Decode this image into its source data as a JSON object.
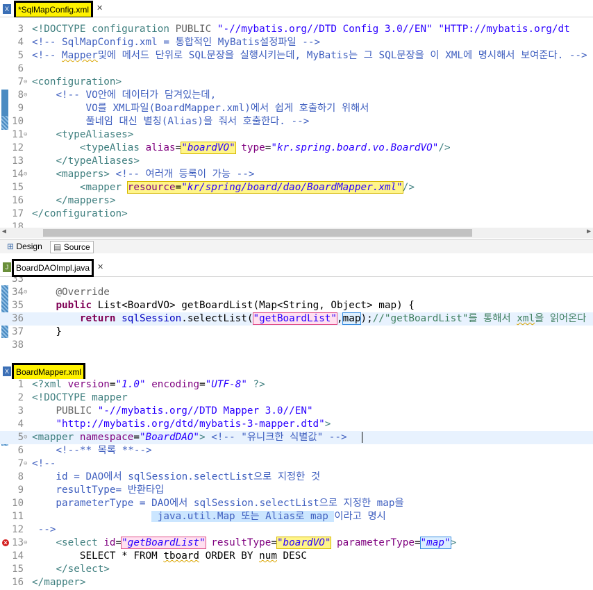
{
  "panel1": {
    "tab_title": "*SqlMapConfig.xml",
    "file_icon": "xml-file-icon",
    "lines": [
      {
        "n": "3",
        "html": "<span class='c-doc'>&lt;!DOCTYPE configuration</span> <span class='c-ann'>PUBLIC</span> <span class='c-str'>\"-//mybatis.org//DTD Config 3.0//EN\"</span> <span class='c-str'>\"HTTP://mybatis.org/dt</span>"
      },
      {
        "n": "4",
        "html": "<span class='c-com'>&lt;!-- SqlMapConfig.xml = 통합적인 MyBatis설정파일 --&gt;</span>"
      },
      {
        "n": "5",
        "html": "<span class='c-com'>&lt;!-- <span class='sq'>Mapper</span>및에 메서드 단위로 SQL문장을 실행시키는데, MyBatis는 그 SQL문장을 이 XML에 명시해서 보여준다. --&gt;</span>"
      },
      {
        "n": "6",
        "html": ""
      },
      {
        "n": "7",
        "fold": "⊖",
        "html": "<span class='c-tag'>&lt;configuration&gt;</span>"
      },
      {
        "n": "8",
        "fold": "⊖",
        "html": "    <span class='c-com'>&lt;!-- VO안에 데이터가 담겨있는데,</span>"
      },
      {
        "n": "9",
        "html": "<span class='c-com'>         VO를 XML파일(BoardMapper.xml)에서 쉽게 호출하기 위해서</span>"
      },
      {
        "n": "10",
        "html": "<span class='c-com'>         풀네임 대신 별칭(Alias)을 줘서 호출한다. --&gt;</span>"
      },
      {
        "n": "11",
        "fold": "⊖",
        "html": "    <span class='c-tag'>&lt;typeAliases&gt;</span>"
      },
      {
        "n": "12",
        "html": "        <span class='c-tag'>&lt;typeAlias</span> <span class='c-attr'>alias</span>=<span class='c-val box-yellow'>\"boardVO\"</span> <span class='c-attr'>type</span>=<span class='c-val'>\"kr.spring.board.vo.BoardVO\"</span><span class='c-tag'>/&gt;</span>"
      },
      {
        "n": "13",
        "html": "    <span class='c-tag'>&lt;/typeAliases&gt;</span>"
      },
      {
        "n": "14",
        "fold": "⊖",
        "html": "    <span class='c-tag'>&lt;mappers&gt;</span> <span class='c-com'>&lt;!-- 여러개 등록이 가능 --&gt;</span>"
      },
      {
        "n": "15",
        "html": "        <span class='c-tag'>&lt;mapper</span> <span class='box-yellow'><span class='c-attr'>resource</span>=<span class='c-val'>\"kr/spring/board/dao/BoardMapper.xml\"</span></span><span class='c-tag'>/&gt;</span>"
      },
      {
        "n": "16",
        "html": "    <span class='c-tag'>&lt;/mappers&gt;</span>"
      },
      {
        "n": "17",
        "html": "<span class='c-tag'>&lt;/configuration&gt;</span>"
      },
      {
        "n": "18",
        "html": ""
      }
    ],
    "bottom_tabs": [
      "Design",
      "Source"
    ]
  },
  "panel2": {
    "tab_title": "BoardDAOImpl.java",
    "file_icon": "java-file-icon",
    "lines": [
      {
        "n": "33",
        "html": ""
      },
      {
        "n": "34",
        "fold": "⊖",
        "html": "    <span class='c-ann'>@Override</span>"
      },
      {
        "n": "35",
        "html": "    <span class='c-kw'>public</span> List&lt;BoardVO&gt; getBoardList(Map&lt;String, Object&gt; map) {"
      },
      {
        "n": "36",
        "cur": true,
        "html": "        <span class='c-kw'>return</span> <span style='color:#0000c0'>sqlSession</span>.selectList(<span class='box-pink c-str'>\"getBoardList\"</span>,<span class='box-blue'>map</span>);<span style='color:#3f7f5f'>//\"getBoardList\"를 통해서 <span class='sq'>xml</span>을 읽어온다</span>"
      },
      {
        "n": "37",
        "html": "    }"
      },
      {
        "n": "38",
        "html": ""
      }
    ]
  },
  "panel3": {
    "tab_title": "BoardMapper.xml",
    "file_icon": "xml-file-icon",
    "lines": [
      {
        "n": "1",
        "html": "<span class='c-tag'>&lt;?xml</span> <span class='c-attr'>version</span>=<span class='c-val'>\"1.0\"</span> <span class='c-attr'>encoding</span>=<span class='c-val'>\"UTF-8\"</span> <span class='c-tag'>?&gt;</span>"
      },
      {
        "n": "2",
        "html": "<span class='c-doc'>&lt;!DOCTYPE mapper</span>"
      },
      {
        "n": "3",
        "html": "    <span class='c-ann'>PUBLIC</span> <span class='c-str'>\"-//mybatis.org//DTD Mapper 3.0//EN\"</span>"
      },
      {
        "n": "4",
        "html": "    <span class='c-str'>\"http://mybatis.org/dtd/mybatis-3-mapper.dtd\"</span><span class='c-doc'>&gt;</span>"
      },
      {
        "n": "5",
        "fold": "⊖",
        "cur": true,
        "html": "<span class='c-tag'>&lt;mapper</span> <span class='c-attr'>namespace</span>=<span class='c-val'>\"BoardDAO\"</span><span class='c-tag'>&gt;</span> <span class='c-com'>&lt;!-- \"유니크한 식별값\" --&gt;</span>"
      },
      {
        "n": "6",
        "html": "    <span class='c-com'>&lt;!--** 목록 **--&gt;</span>"
      },
      {
        "n": "7",
        "fold": "⊖",
        "html": "<span class='c-com'>&lt;!--</span>"
      },
      {
        "n": "8",
        "html": "<span class='c-com'>    id = DAO에서 sqlSession.selectList으로 지정한 것</span>"
      },
      {
        "n": "9",
        "html": "<span class='c-com'>    resultType= 반환타입</span>"
      },
      {
        "n": "10",
        "html": "<span class='c-com'>    parameterType = DAO에서 sqlSession.selectList으로 지정한 map을</span>"
      },
      {
        "n": "11",
        "html": "<span class='c-com'>                    <span class='box-lblue'> java.util.Map 또는 Alias로 map </span>이라고 명시</span>"
      },
      {
        "n": "12",
        "html": "<span class='c-com'> --&gt;</span>"
      },
      {
        "n": "13",
        "fold": "⊖",
        "err": true,
        "html": "    <span class='c-tag'>&lt;select</span> <span class='c-attr'>id</span>=<span class='c-val box-pink'>\"getBoardList\"</span> <span class='c-attr'>resultType</span>=<span class='c-val box-yellow'>\"boardVO\"</span> <span class='c-attr'>parameterType</span>=<span class='c-val box-blue'>\"map\"</span><span class='c-tag'>&gt;</span>"
      },
      {
        "n": "14",
        "html": "        SELECT * FROM <span class='sq'>tboard</span> ORDER BY <span class='sq'>num</span> DESC"
      },
      {
        "n": "15",
        "html": "    <span class='c-tag'>&lt;/select&gt;</span>"
      },
      {
        "n": "16",
        "html": "<span class='c-tag'>&lt;/mapper&gt;</span>"
      }
    ]
  }
}
